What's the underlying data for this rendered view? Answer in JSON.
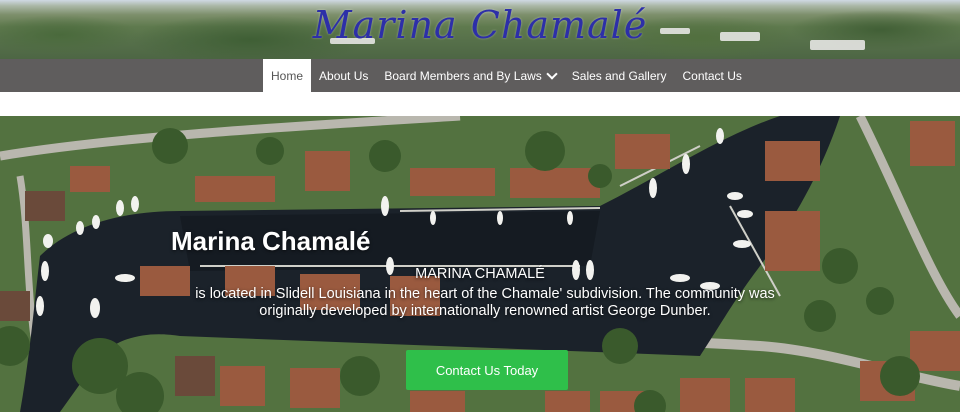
{
  "site": {
    "title": "Marina Chamalé"
  },
  "nav": {
    "items": [
      {
        "label": "Home",
        "active": true
      },
      {
        "label": "About Us"
      },
      {
        "label": "Board Members and By Laws",
        "has_dropdown": true
      },
      {
        "label": "Sales and Gallery"
      },
      {
        "label": "Contact Us"
      }
    ]
  },
  "hero": {
    "heading": "Marina Chamalé",
    "subheading": "MARINA CHAMALÉ",
    "body": "is located in Slidell Louisiana in the heart of the Chamale' subdivision. The community was originally developed by internationally renowned artist George Dunber.",
    "cta_label": "Contact Us Today"
  },
  "colors": {
    "title_blue": "#2d2fa8",
    "nav_bg": "#5f5d5d",
    "cta_green": "#2fbf4a"
  }
}
